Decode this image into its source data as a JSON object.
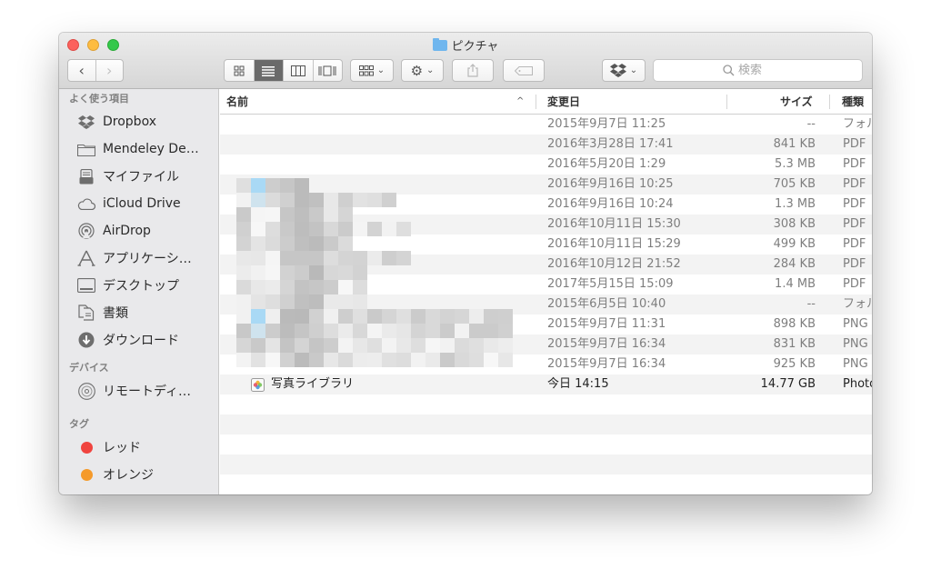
{
  "window": {
    "title": "ピクチャ"
  },
  "search": {
    "placeholder": "検索"
  },
  "sidebar": {
    "favorites_header": "よく使う項目",
    "favorites": [
      {
        "label": "Dropbox",
        "icon": "dropbox-icon"
      },
      {
        "label": "Mendeley De…",
        "icon": "folder-icon"
      },
      {
        "label": "マイファイル",
        "icon": "all-my-files-icon"
      },
      {
        "label": "iCloud Drive",
        "icon": "cloud-icon"
      },
      {
        "label": "AirDrop",
        "icon": "airdrop-icon"
      },
      {
        "label": "アプリケーシ…",
        "icon": "applications-icon"
      },
      {
        "label": "デスクトップ",
        "icon": "desktop-icon"
      },
      {
        "label": "書類",
        "icon": "documents-icon"
      },
      {
        "label": "ダウンロード",
        "icon": "downloads-icon"
      }
    ],
    "devices_header": "デバイス",
    "devices": [
      {
        "label": "リモートディ…",
        "icon": "remote-disc-icon"
      }
    ],
    "tags_header": "タグ",
    "tags": [
      {
        "label": "レッド",
        "color": "#f0443f"
      },
      {
        "label": "オレンジ",
        "color": "#f59a2a"
      }
    ]
  },
  "columns": {
    "name": "名前",
    "date": "変更日",
    "size": "サイズ",
    "kind": "種類"
  },
  "files": [
    {
      "name": "",
      "date": "2015年9月7日 11:25",
      "size": "--",
      "kind": "フォル"
    },
    {
      "name": "",
      "date": "2016年3月28日 17:41",
      "size": "841 KB",
      "kind": "PDF"
    },
    {
      "name": "",
      "date": "2016年5月20日 1:29",
      "size": "5.3 MB",
      "kind": "PDF"
    },
    {
      "name": "",
      "date": "2016年9月16日 10:25",
      "size": "705 KB",
      "kind": "PDF"
    },
    {
      "name": "",
      "date": "2016年9月16日 10:24",
      "size": "1.3 MB",
      "kind": "PDF"
    },
    {
      "name": "",
      "date": "2016年10月11日 15:30",
      "size": "308 KB",
      "kind": "PDF"
    },
    {
      "name": "",
      "date": "2016年10月11日 15:29",
      "size": "499 KB",
      "kind": "PDF"
    },
    {
      "name": "",
      "date": "2016年10月12日 21:52",
      "size": "284 KB",
      "kind": "PDF"
    },
    {
      "name": "",
      "date": "2017年5月15日 15:09",
      "size": "1.4 MB",
      "kind": "PDF"
    },
    {
      "name": "",
      "date": "2015年6月5日 10:40",
      "size": "--",
      "kind": "フォル"
    },
    {
      "name": "",
      "date": "2015年9月7日 11:31",
      "size": "898 KB",
      "kind": "PNG"
    },
    {
      "name": "",
      "date": "2015年9月7日 16:34",
      "size": "831 KB",
      "kind": "PNG"
    },
    {
      "name": "",
      "date": "2015年9月7日 16:34",
      "size": "925 KB",
      "kind": "PNG"
    },
    {
      "name": "写真ライブラリ",
      "date": "今日 14:15",
      "size": "14.77 GB",
      "kind": "Photo"
    }
  ]
}
